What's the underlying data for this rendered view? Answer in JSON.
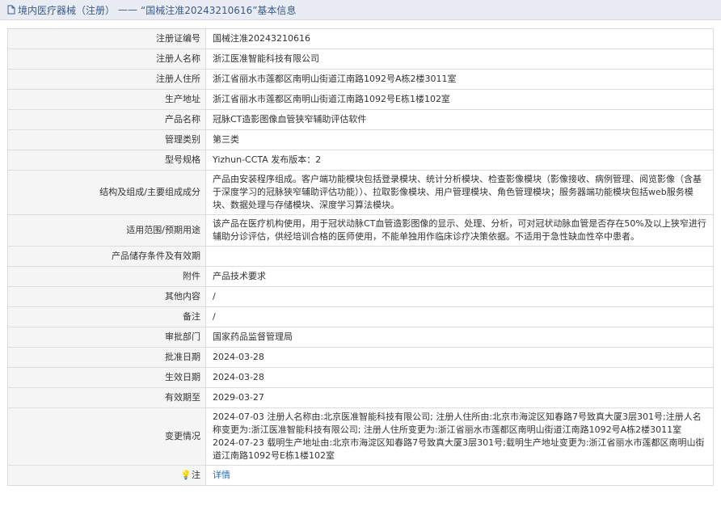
{
  "header": {
    "prefix": "境内医疗器械（注册）",
    "separator": "——",
    "title": "“国械注准20243210616”基本信息"
  },
  "rows": [
    {
      "label": "注册证编号",
      "value": "国械注准20243210616"
    },
    {
      "label": "注册人名称",
      "value": "浙江医准智能科技有限公司"
    },
    {
      "label": "注册人住所",
      "value": "浙江省丽水市莲都区南明山街道江南路1092号A栋2楼3011室"
    },
    {
      "label": "生产地址",
      "value": "浙江省丽水市莲都区南明山街道江南路1092号E栋1楼102室"
    },
    {
      "label": "产品名称",
      "value": "冠脉CT造影图像血管狭窄辅助评估软件"
    },
    {
      "label": "管理类别",
      "value": "第三类"
    },
    {
      "label": "型号规格",
      "value": "Yizhun-CCTA 发布版本：2"
    },
    {
      "label": "结构及组成/主要组成成分",
      "value": "产品由安装程序组成。客户端功能模块包括登录模块、统计分析模块、检查影像模块（影像接收、病例管理、阅览影像（含基于深度学习的冠脉狭窄辅助评估功能））、拉取影像模块、用户管理模块、角色管理模块；服务器端功能模块包括web服务模块、数据处理与存储模块、深度学习算法模块。"
    },
    {
      "label": "适用范围/预期用途",
      "value": "该产品在医疗机构使用，用于冠状动脉CT血管造影图像的显示、处理、分析，可对冠状动脉血管是否存在50%及以上狭窄进行辅助分诊评估，供经培训合格的医师使用，不能单独用作临床诊疗决策依据。不适用于急性缺血性卒中患者。"
    },
    {
      "label": "产品储存条件及有效期",
      "value": ""
    },
    {
      "label": "附件",
      "value": "产品技术要求"
    },
    {
      "label": "其他内容",
      "value": "/"
    },
    {
      "label": "备注",
      "value": "/"
    },
    {
      "label": "审批部门",
      "value": "国家药品监督管理局"
    },
    {
      "label": "批准日期",
      "value": "2024-03-28"
    },
    {
      "label": "生效日期",
      "value": "2024-03-28"
    },
    {
      "label": "有效期至",
      "value": "2029-03-27"
    }
  ],
  "change": {
    "label": "变更情况",
    "line1": "2024-07-03 注册人名称由:北京医准智能科技有限公司; 注册人住所由:北京市海淀区知春路7号致真大厦3层301号;注册人名称变更为:浙江医准智能科技有限公司; 注册人住所变更为:浙江省丽水市莲都区南明山街道江南路1092号A栋2楼3011室",
    "line2": "2024-07-23 载明生产地址由:北京市海淀区知春路7号致真大厦3层301号;载明生产地址变更为:浙江省丽水市莲都区南明山街道江南路1092号E栋1楼102室"
  },
  "note": {
    "label": "注",
    "link": "详情"
  }
}
